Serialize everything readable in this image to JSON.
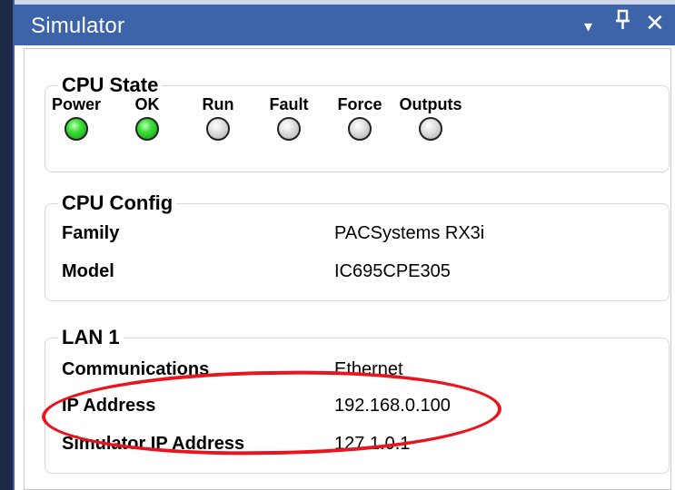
{
  "window": {
    "title": "Simulator",
    "controls": {
      "dropdown": "▾",
      "pin": "ᅮ",
      "close": "✕"
    }
  },
  "cpu_state": {
    "title": "CPU State",
    "leds": [
      {
        "label": "Power",
        "on": true
      },
      {
        "label": "OK",
        "on": true
      },
      {
        "label": "Run",
        "on": false
      },
      {
        "label": "Fault",
        "on": false
      },
      {
        "label": "Force",
        "on": false
      },
      {
        "label": "Outputs",
        "on": false
      }
    ]
  },
  "cpu_config": {
    "title": "CPU Config",
    "rows": [
      {
        "label": "Family",
        "value": "PACSystems RX3i"
      },
      {
        "label": "Model",
        "value": "IC695CPE305"
      }
    ]
  },
  "lan": {
    "title": "LAN 1",
    "rows": [
      {
        "label": "Communications",
        "value": "Ethernet"
      },
      {
        "label": "IP Address",
        "value": "192.168.0.100"
      },
      {
        "label": "Simulator IP Address",
        "value": "127.1.0.1"
      }
    ]
  },
  "colors": {
    "titlebar": "#3d63a8",
    "led_on": "#1fc41c",
    "led_off": "#cfcfcf",
    "annotation": "#e8141e"
  }
}
